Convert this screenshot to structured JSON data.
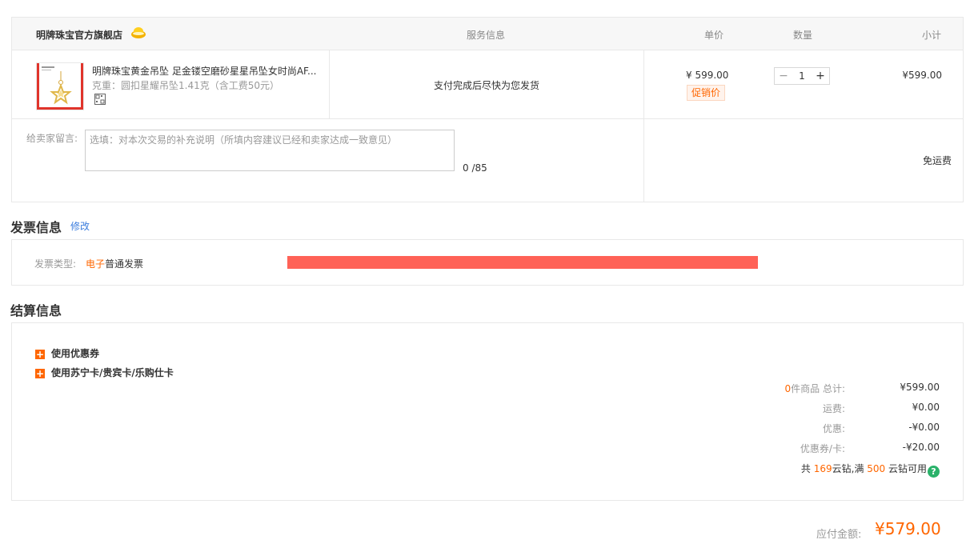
{
  "order": {
    "shop_name": "明牌珠宝官方旗舰店",
    "shop_icon": "gold-ingot-icon",
    "headers": {
      "service": "服务信息",
      "unit_price": "单价",
      "quantity": "数量",
      "subtotal": "小计"
    },
    "product": {
      "title": "明牌珠宝黄金吊坠 足金镂空磨砂星星吊坠女时尚AF...",
      "spec": "克重：圆扣星耀吊坠1.41克（含工费50元）",
      "qr_icon": "qr-code-icon",
      "service": "支付完成后尽快为您发货",
      "unit_price": "¥ 599.00",
      "promo_label": "促销价",
      "quantity": "1",
      "minus": "−",
      "plus": "+",
      "subtotal": "¥599.00"
    },
    "message": {
      "label": "给卖家留言:",
      "placeholder": "选填：对本次交易的补充说明（所填内容建议已经和卖家达成一致意见）",
      "counter": "0 /85"
    },
    "shipping": "免运费"
  },
  "invoice": {
    "title": "发票信息",
    "edit": "修改",
    "type_label": "发票类型:",
    "type_highlight": "电子",
    "type_rest": "普通发票"
  },
  "settlement": {
    "title": "结算信息",
    "coupon": "使用优惠券",
    "cards": "使用苏宁卡/贵宾卡/乐购仕卡",
    "items_count": "0",
    "items_label": "件商品 总计:",
    "total": "¥599.00",
    "freight_label": "运费:",
    "freight": "¥0.00",
    "discount_label": "优惠:",
    "discount": "-¥0.00",
    "coupon_label": "优惠券/卡:",
    "coupon_value": "-¥20.00",
    "yun_prefix": "共 ",
    "yun_count": "169",
    "yun_mid": "云钻,满 ",
    "yun_threshold": "500",
    "yun_suffix": " 云钻可用",
    "help_icon": "?"
  },
  "payment": {
    "label": "应付金额:",
    "amount": "¥579.00"
  },
  "colors": {
    "accent": "#ff6600",
    "link": "#3b7ddd",
    "redaction": "#ff6257",
    "help": "#2ab26a"
  }
}
